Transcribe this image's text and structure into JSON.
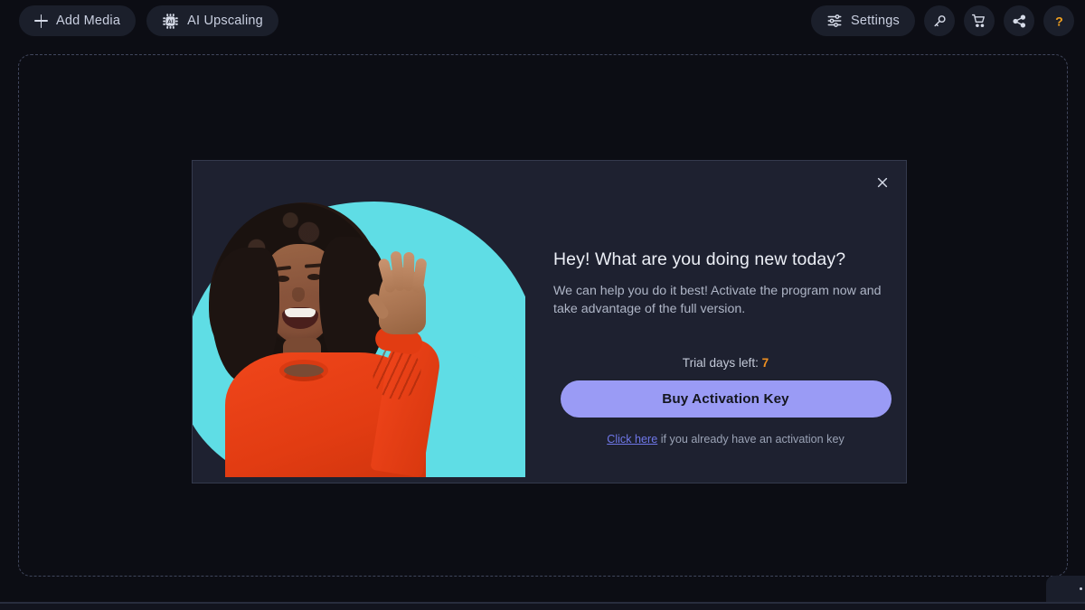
{
  "toolbar": {
    "add_media_label": "Add Media",
    "add_media_icon": "plus-icon",
    "ai_upscaling_label": "AI Upscaling",
    "ai_upscaling_icon": "ai-chip-icon",
    "settings_label": "Settings",
    "settings_icon": "sliders-icon",
    "key_icon": "key-icon",
    "cart_icon": "shopping-cart-icon",
    "share_icon": "share-icon",
    "help_icon": "question-mark-icon",
    "help_color": "#f0a020"
  },
  "workspace": {
    "dropzone_name": "media-dropzone"
  },
  "dialog": {
    "close_icon": "close-icon",
    "title": "Hey! What are you doing new today?",
    "subtitle": "We can help you do it best! Activate the program now and take advantage of the full version.",
    "trial_label": "Trial days left:",
    "trial_days": "7",
    "trial_days_color": "#f09020",
    "cta_label": "Buy Activation Key",
    "cta_color": "#9a9bf5",
    "note_link": "Click here",
    "note_text": " if you already have an activation key",
    "artwork_alt": "waving-woman-photo",
    "artwork_accent": "#5fdde5",
    "artwork_garment": "#e23c12"
  }
}
